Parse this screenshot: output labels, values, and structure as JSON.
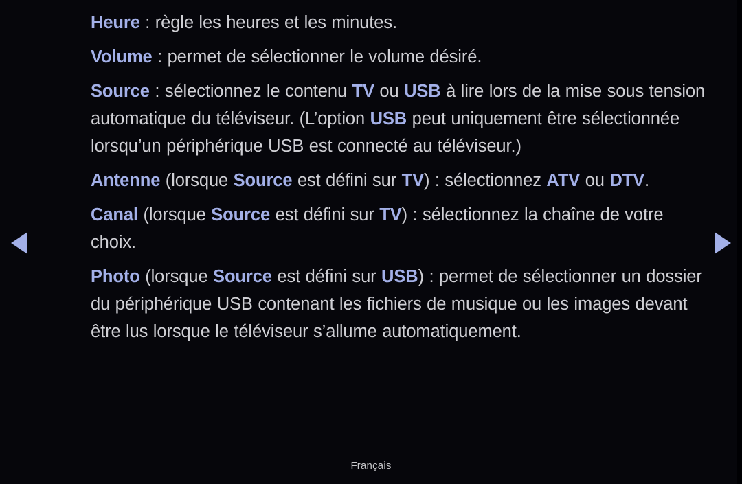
{
  "screen": {
    "background_color": "#06060b",
    "accent_color": "#a3b0e8",
    "body_text_color": "#cfcfd4",
    "footer_text_color": "#c6c6c9"
  },
  "nav": {
    "prev_label": "◀",
    "next_label": "▶",
    "prev_icon": "triangle-left-icon",
    "next_icon": "triangle-right-icon"
  },
  "content": {
    "paragraphs": [
      {
        "id": "heure",
        "keyword": "Heure",
        "segments": [
          {
            "text": " : règle les heures et les minutes.",
            "style": "normal"
          }
        ]
      },
      {
        "id": "volume",
        "keyword": "Volume",
        "segments": [
          {
            "text": " : permet de sélectionner le volume désiré.",
            "style": "normal"
          }
        ]
      },
      {
        "id": "source",
        "keyword": "Source",
        "segments": [
          {
            "text": " : sélectionnez le contenu ",
            "style": "normal"
          },
          {
            "text": "TV",
            "style": "token"
          },
          {
            "text": " ou ",
            "style": "normal"
          },
          {
            "text": "USB",
            "style": "token"
          },
          {
            "text": " à lire lors de la mise sous tension automatique du téléviseur. (L’option ",
            "style": "normal"
          },
          {
            "text": "USB",
            "style": "token"
          },
          {
            "text": " peut uniquement être sélectionnée lorsqu’un périphérique USB est connecté au téléviseur.)",
            "style": "normal"
          }
        ]
      },
      {
        "id": "antenne",
        "keyword": "Antenne",
        "segments": [
          {
            "text": " (lorsque ",
            "style": "normal"
          },
          {
            "text": "Source",
            "style": "token"
          },
          {
            "text": " est défini sur ",
            "style": "normal"
          },
          {
            "text": "TV",
            "style": "token"
          },
          {
            "text": ") : sélectionnez ",
            "style": "normal"
          },
          {
            "text": "ATV",
            "style": "token"
          },
          {
            "text": " ou ",
            "style": "normal"
          },
          {
            "text": "DTV",
            "style": "token"
          },
          {
            "text": ".",
            "style": "normal"
          }
        ]
      },
      {
        "id": "canal",
        "keyword": "Canal",
        "segments": [
          {
            "text": " (lorsque ",
            "style": "normal"
          },
          {
            "text": "Source",
            "style": "token"
          },
          {
            "text": " est défini sur ",
            "style": "normal"
          },
          {
            "text": "TV",
            "style": "token"
          },
          {
            "text": ") : sélectionnez la chaîne de votre choix.",
            "style": "normal"
          }
        ]
      },
      {
        "id": "photo",
        "keyword": "Photo",
        "segments": [
          {
            "text": " (lorsque ",
            "style": "normal"
          },
          {
            "text": "Source",
            "style": "token"
          },
          {
            "text": " est défini sur ",
            "style": "normal"
          },
          {
            "text": "USB",
            "style": "token"
          },
          {
            "text": ") : permet de sélectionner un dossier du périphérique USB contenant les fichiers de musique ou les images devant être lus lorsque le téléviseur s’allume automatiquement.",
            "style": "normal"
          }
        ]
      }
    ]
  },
  "footer": {
    "language": "Français"
  }
}
